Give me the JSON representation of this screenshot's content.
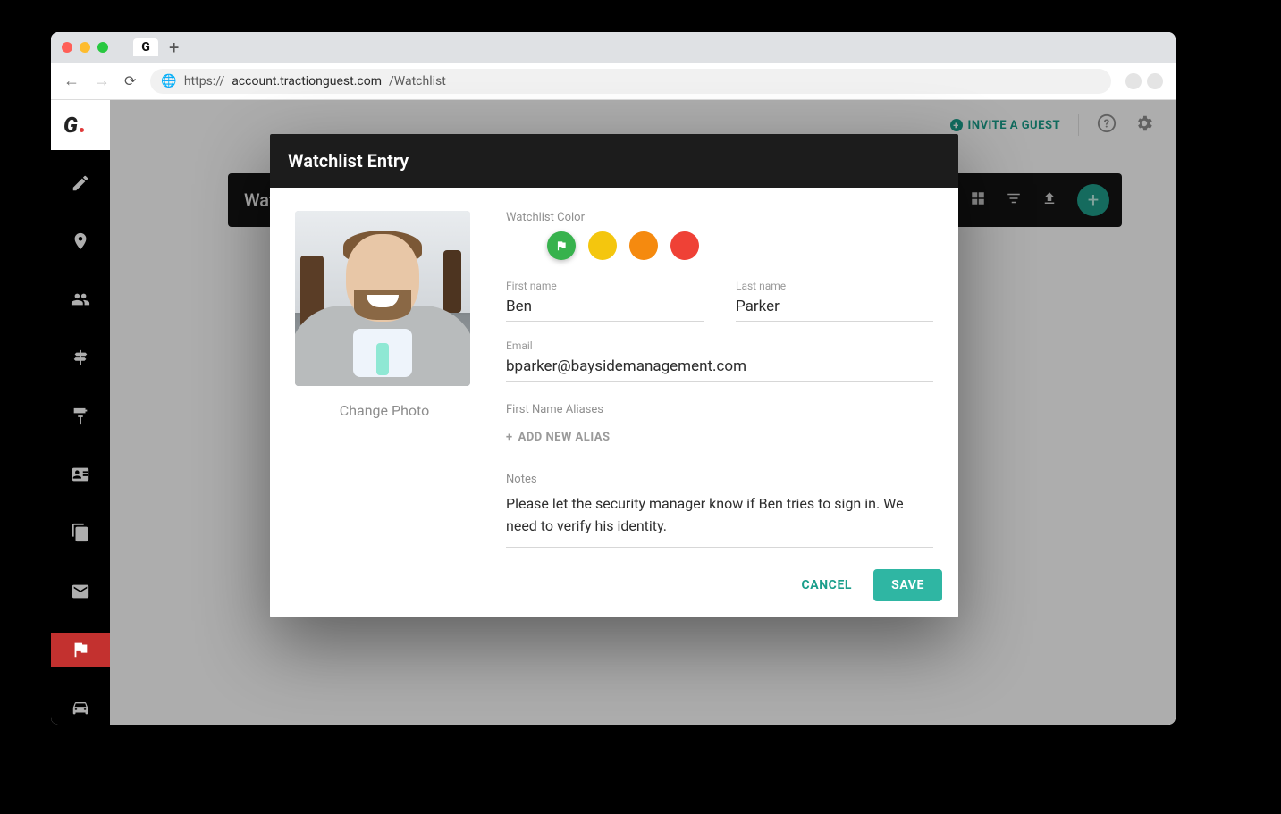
{
  "browser": {
    "url_prefix": "https://",
    "url_domain": "account.tractionguest.com",
    "url_path": "/Watchlist",
    "tab_glyph": "G"
  },
  "header": {
    "invite_label": "INVITE A GUEST"
  },
  "toolbar": {
    "title": "Watchlist"
  },
  "modal": {
    "title": "Watchlist Entry",
    "change_photo": "Change Photo",
    "color_label": "Watchlist Color",
    "colors": {
      "green": "#37b24d",
      "yellow": "#f4c60e",
      "orange": "#f58a0f",
      "red": "#ef4136",
      "selected": "green"
    },
    "fields": {
      "first_name_label": "First name",
      "first_name_value": "Ben",
      "last_name_label": "Last name",
      "last_name_value": "Parker",
      "email_label": "Email",
      "email_value": "bparker@baysidemanagement.com",
      "aliases_label": "First Name Aliases",
      "add_alias_label": "ADD NEW ALIAS",
      "notes_label": "Notes",
      "notes_value": "Please let the security manager know if Ben tries to sign in. We need to verify his identity."
    },
    "buttons": {
      "cancel": "CANCEL",
      "save": "SAVE"
    }
  }
}
